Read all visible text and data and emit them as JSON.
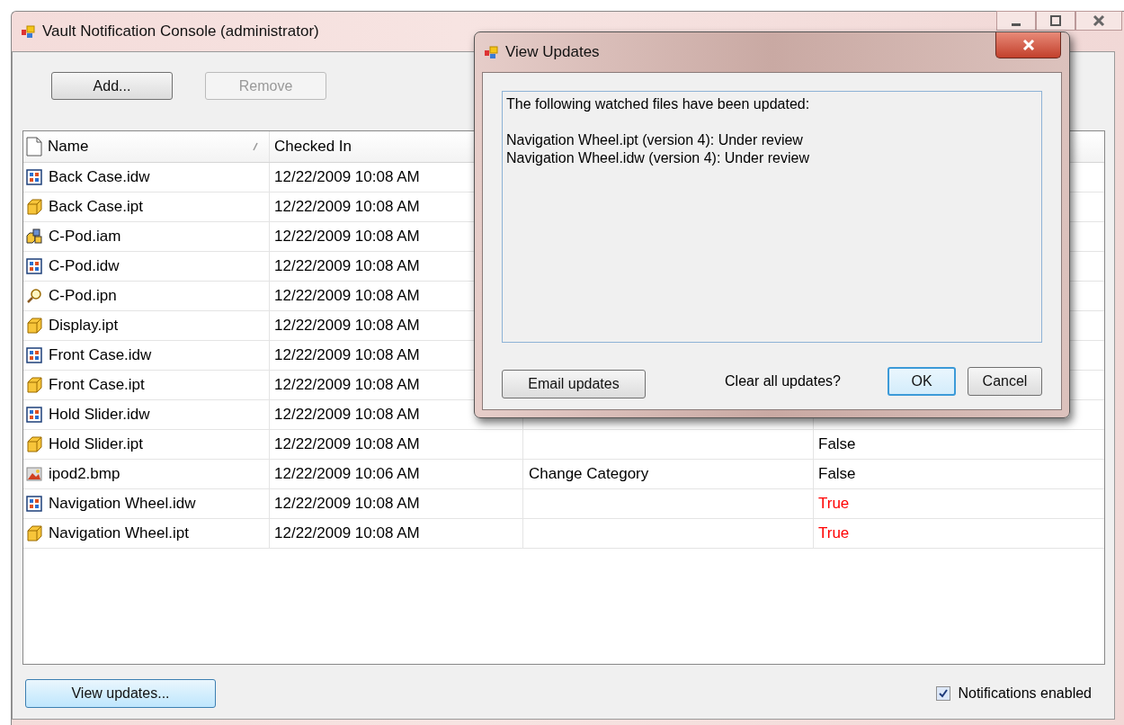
{
  "window": {
    "title": "Vault Notification Console (administrator)"
  },
  "toolbar": [
    {
      "label": "Add...",
      "disabled": false
    },
    {
      "label": "Remove",
      "disabled": true
    }
  ],
  "table": {
    "columns": [
      "Name",
      "Checked In"
    ],
    "rows": [
      {
        "kind": "drawing",
        "name": "Back Case.idw",
        "checked_in": "12/22/2009 10:08 AM"
      },
      {
        "kind": "part",
        "name": "Back Case.ipt",
        "checked_in": "12/22/2009 10:08 AM"
      },
      {
        "kind": "assembly",
        "name": "C-Pod.iam",
        "checked_in": "12/22/2009 10:08 AM"
      },
      {
        "kind": "drawing",
        "name": "C-Pod.idw",
        "checked_in": "12/22/2009 10:08 AM"
      },
      {
        "kind": "presentation",
        "name": "C-Pod.ipn",
        "checked_in": "12/22/2009 10:08 AM"
      },
      {
        "kind": "part",
        "name": "Display.ipt",
        "checked_in": "12/22/2009 10:08 AM"
      },
      {
        "kind": "drawing",
        "name": "Front Case.idw",
        "checked_in": "12/22/2009 10:08 AM"
      },
      {
        "kind": "part",
        "name": "Front Case.ipt",
        "checked_in": "12/22/2009 10:08 AM"
      },
      {
        "kind": "drawing",
        "name": "Hold Slider.idw",
        "checked_in": "12/22/2009 10:08 AM"
      },
      {
        "kind": "part",
        "name": "Hold Slider.ipt",
        "checked_in": "12/22/2009 10:08 AM",
        "column_4": "False",
        "updated": false
      },
      {
        "kind": "image",
        "name": "ipod2.bmp",
        "checked_in": "12/22/2009 10:06 AM",
        "column_3": "Change Category",
        "column_4": "False",
        "updated": false
      },
      {
        "kind": "drawing",
        "name": "Navigation Wheel.idw",
        "checked_in": "12/22/2009 10:08 AM",
        "column_4": "True",
        "updated": true
      },
      {
        "kind": "part",
        "name": "Navigation Wheel.ipt",
        "checked_in": "12/22/2009 10:08 AM",
        "column_4": "True",
        "updated": true
      }
    ]
  },
  "footer": {
    "button": "View updates...",
    "checkbox": {
      "label": "Notifications enabled",
      "checked": true
    }
  },
  "dialog": {
    "title": "View Updates",
    "heading": "The following watched files have been updated:",
    "lines": [
      "Navigation Wheel.ipt (version 4): Under review",
      "Navigation Wheel.idw (version 4): Under review"
    ],
    "email_button": "Email updates",
    "question": "Clear all updates?",
    "ok": "OK",
    "cancel": "Cancel"
  }
}
